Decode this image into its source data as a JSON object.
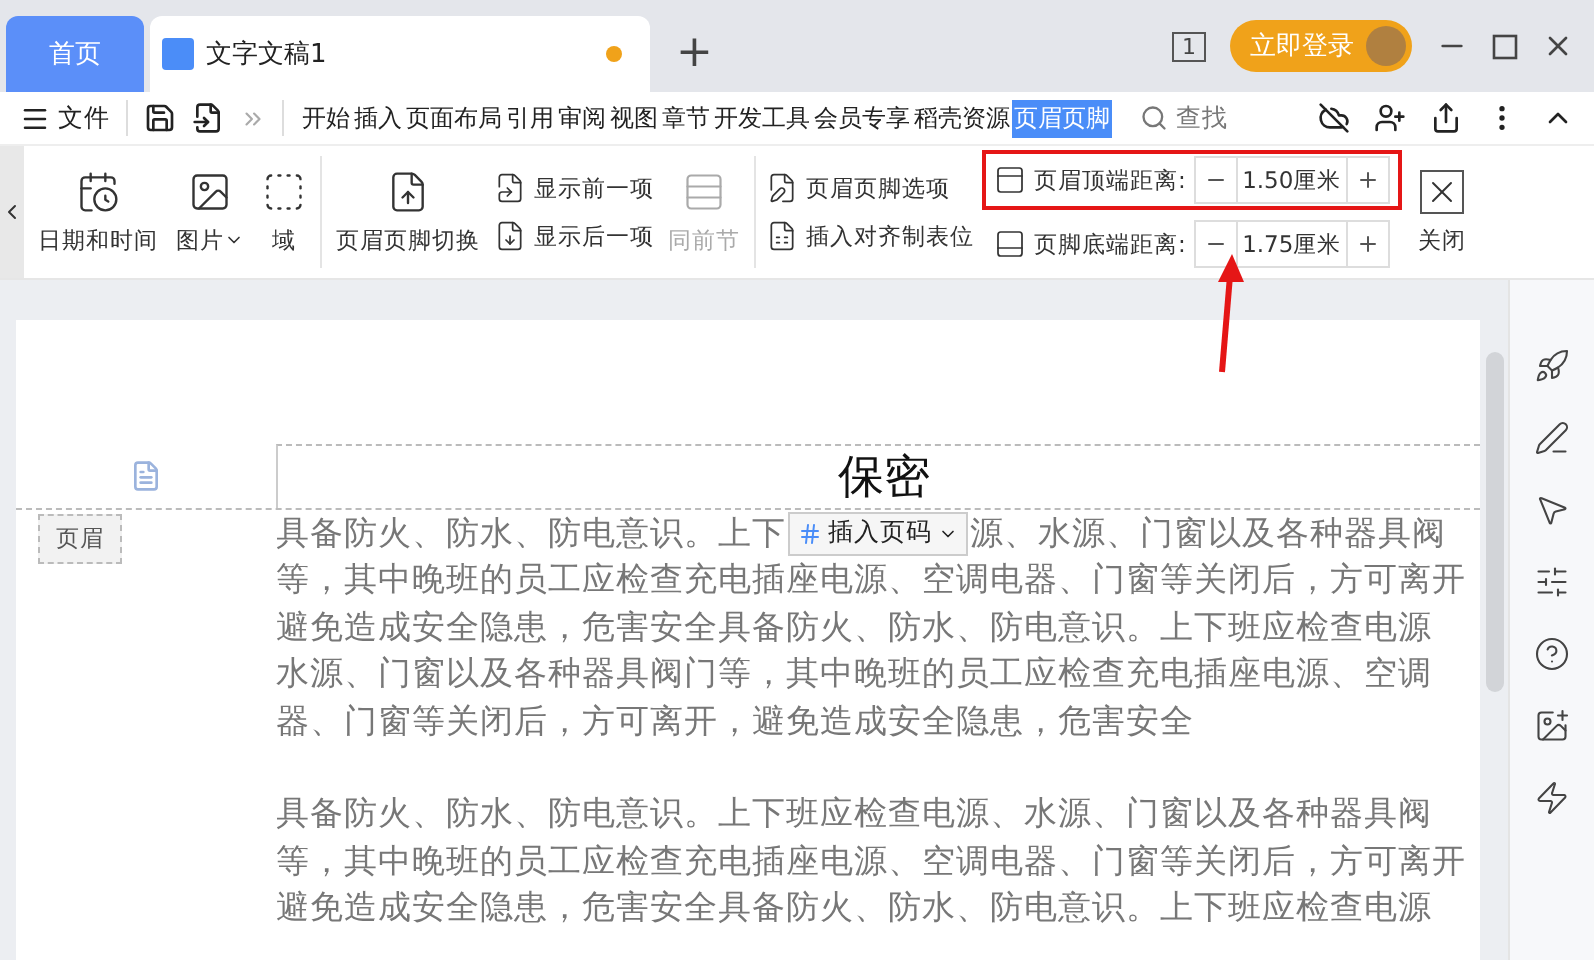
{
  "tabs": [
    {
      "label": "首页",
      "kind": "home",
      "selected": false
    },
    {
      "label": "文字文稿1",
      "kind": "doc",
      "selected": true,
      "unsaved": true
    }
  ],
  "new_tab": "+",
  "page_counter": "1",
  "login_button": "立即登录",
  "menu": {
    "file": "文件",
    "search": "查找",
    "ribbon_tabs": [
      {
        "label": "开始",
        "selected": false
      },
      {
        "label": "插入",
        "selected": false
      },
      {
        "label": "页面布局",
        "selected": false
      },
      {
        "label": "引用",
        "selected": false
      },
      {
        "label": "审阅",
        "selected": false
      },
      {
        "label": "视图",
        "selected": false
      },
      {
        "label": "章节",
        "selected": false
      },
      {
        "label": "开发工具",
        "selected": false
      },
      {
        "label": "会员专享",
        "selected": false
      },
      {
        "label": "稻壳资源",
        "selected": false
      },
      {
        "label": "页眉页脚",
        "selected": true
      }
    ]
  },
  "ribbon": {
    "large_tools": [
      {
        "label": "日期和时间",
        "kind": "calendar",
        "dropdown": false
      },
      {
        "label": "图片",
        "kind": "picture",
        "dropdown": true
      },
      {
        "label": "域",
        "kind": "field",
        "dropdown": false
      },
      {
        "label": "页眉页脚切换",
        "kind": "switch",
        "dropdown": false
      }
    ],
    "small_tools": [
      {
        "label": "显示前一项",
        "kind": "prev",
        "disabled": false
      },
      {
        "label": "显示后一项",
        "kind": "next",
        "disabled": false
      }
    ],
    "same_as_previous": {
      "label": "同前节",
      "disabled": true
    },
    "option_tools": [
      {
        "label": "页眉页脚选项",
        "kind": "options"
      },
      {
        "label": "插入对齐制表位",
        "kind": "tab-stop"
      }
    ],
    "spinners": [
      {
        "label": "页眉顶端距离:",
        "value": "1.50厘米",
        "kind": "header",
        "highlighted": true
      },
      {
        "label": "页脚底端距离:",
        "value": "1.75厘米",
        "kind": "footer",
        "highlighted": false
      }
    ],
    "close": "关闭"
  },
  "document": {
    "header_text": "保密",
    "header_label": "页眉",
    "insert_page_number": "插入页码",
    "paragraphs": [
      [
        [
          "具备防火、防水、防电意识。上下",
          "源、水源、门窗以及各种器具阀"
        ],
        "等，其中晚班的员工应检查充电插座电源、空调电器、门窗等关闭后，方可离开",
        "避免造成安全隐患，危害安全具备防火、防水、防电意识。上下班应检查电源",
        "水源、门窗以及各种器具阀门等，其中晚班的员工应检查充电插座电源、空调",
        "器、门窗等关闭后，方可离开，避免造成安全隐患，危害安全"
      ],
      [
        "具备防火、防水、防电意识。上下班应检查电源、水源、门窗以及各种器具阀",
        "等，其中晚班的员工应检查充电插座电源、空调电器、门窗等关闭后，方可离开",
        "避免造成安全隐患，危害安全具备防火、防水、防电意识。上下班应检查电源"
      ]
    ]
  }
}
